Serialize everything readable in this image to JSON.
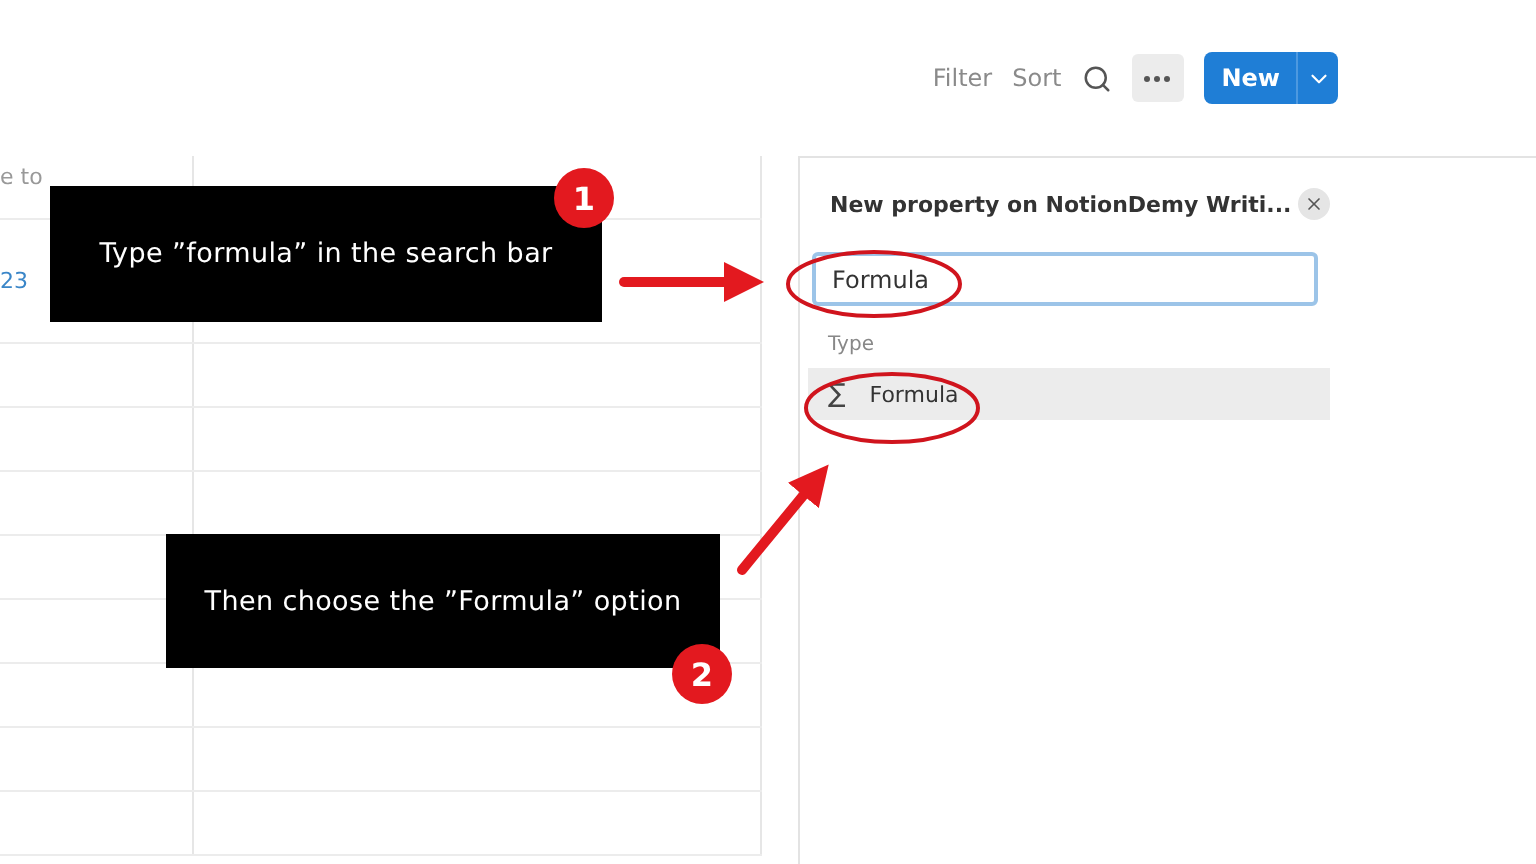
{
  "toolbar": {
    "filter": "Filter",
    "sort": "Sort",
    "new": "New"
  },
  "table": {
    "header": "e to",
    "rows": [
      {
        "cell": "23"
      },
      {
        "cell": ""
      },
      {
        "cell": ""
      },
      {
        "cell": ""
      },
      {
        "cell": ""
      },
      {
        "cell": ""
      },
      {
        "cell": ""
      },
      {
        "cell": ""
      },
      {
        "cell": ""
      }
    ]
  },
  "panel": {
    "title": "New property on NotionDemy Writi...",
    "search": {
      "value": "Formula"
    },
    "section": "Type",
    "options": [
      {
        "icon": "∑",
        "label": "Formula",
        "selected": true
      }
    ]
  },
  "annotations": [
    {
      "number": "1",
      "text": "Type ”formula” in the search bar"
    },
    {
      "number": "2",
      "text": "Then choose the ”Formula” option"
    }
  ]
}
